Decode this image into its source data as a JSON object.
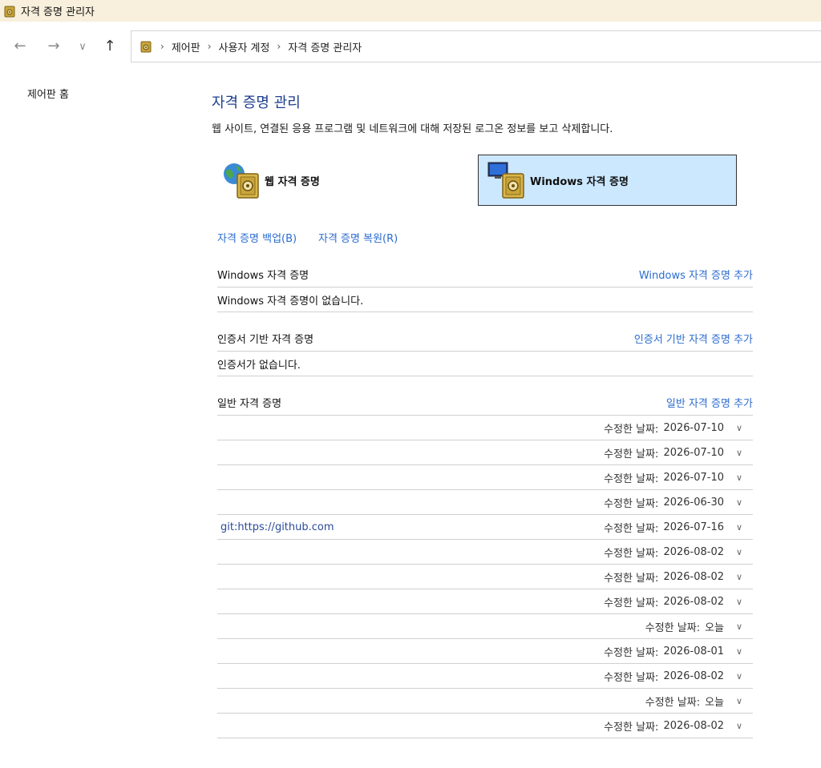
{
  "window": {
    "title": "자격 증명 관리자"
  },
  "colors": {
    "accent": "#2b6cd0",
    "title": "#1e3e8e",
    "selected_tab_bg": "#cce8ff",
    "titlebar_bg": "#f8f0dc"
  },
  "nav": {
    "back_icon": "←",
    "forward_icon": "→",
    "recent_icon": "∨",
    "up_icon": "↑",
    "sep": "›",
    "breadcrumbs": [
      "제어판",
      "사용자 계정",
      "자격 증명 관리자"
    ]
  },
  "sidebar": {
    "home_label": "제어판 홈"
  },
  "main": {
    "title": "자격 증명 관리",
    "description": "웹 사이트, 연결된 응용 프로그램 및 네트워크에 대해 저장된 로그온 정보를 보고 삭제합니다.",
    "tabs": [
      {
        "label": "웹 자격 증명",
        "icon": "globe-vault-icon"
      },
      {
        "label": "Windows 자격 증명",
        "icon": "computer-vault-icon",
        "selected": true
      }
    ],
    "backup_label": "자격 증명 백업(B)",
    "restore_label": "자격 증명 복원(R)",
    "windows_section": {
      "title": "Windows 자격 증명",
      "add_label": "Windows 자격 증명 추가",
      "empty_text": "Windows 자격 증명이 없습니다."
    },
    "cert_section": {
      "title": "인증서 기반 자격 증명",
      "add_label": "인증서 기반 자격 증명 추가",
      "empty_text": "인증서가 없습니다."
    },
    "generic_section": {
      "title": "일반 자격 증명",
      "add_label": "일반 자격 증명 추가",
      "date_label": "수정한 날짜:",
      "chevron": "∨",
      "rows": [
        {
          "name": "",
          "date": "2026-07-10"
        },
        {
          "name": "",
          "date": "2026-07-10"
        },
        {
          "name": "",
          "date": "2026-07-10"
        },
        {
          "name": "",
          "date": "2026-06-30"
        },
        {
          "name": "git:https://github.com",
          "date": "2026-07-16"
        },
        {
          "name": "",
          "date": "2026-08-02"
        },
        {
          "name": "",
          "date": "2026-08-02"
        },
        {
          "name": "",
          "date": "2026-08-02"
        },
        {
          "name": "",
          "date": "오늘"
        },
        {
          "name": "",
          "date": "2026-08-01"
        },
        {
          "name": "",
          "date": "2026-08-02"
        },
        {
          "name": "",
          "date": "오늘"
        },
        {
          "name": "",
          "date": "2026-08-02"
        }
      ]
    }
  }
}
